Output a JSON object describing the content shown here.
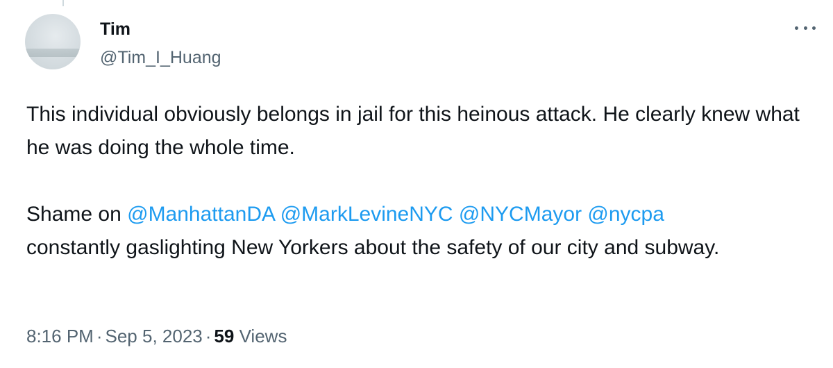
{
  "author": {
    "display_name": "Tim",
    "handle": "@Tim_I_Huang"
  },
  "tweet": {
    "line1": "This individual obviously belongs in jail for this heinous attack. He clearly knew what he was doing the whole time.",
    "shame_prefix": "Shame on",
    "mentions": [
      "@ManhattanDA",
      "@MarkLevineNYC",
      "@NYCMayor",
      "@nycpa"
    ],
    "shame_rest": "constantly gaslighting New Yorkers about the safety of our city and subway."
  },
  "meta": {
    "time": "8:16 PM",
    "separator": "·",
    "date": "Sep 5, 2023",
    "views_count": "59",
    "views_label": "Views"
  },
  "icons": {
    "more": "more-horizontal-icon"
  },
  "colors": {
    "mention": "#1d9bf0",
    "secondary_text": "#536471",
    "primary_text": "#0f1419"
  }
}
